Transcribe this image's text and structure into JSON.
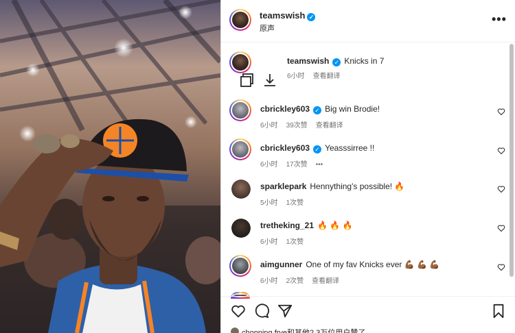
{
  "post": {
    "author": "teamswish",
    "audio": "原声"
  },
  "caption": {
    "author": "teamswish",
    "text": "Knicks in 7",
    "time": "6小时",
    "translate": "查看翻译"
  },
  "comments": [
    {
      "user": "cbrickley603",
      "verified": true,
      "text": "Big win Brodie!",
      "time": "6小时",
      "likes": "39次赞",
      "translate": "查看翻译"
    },
    {
      "user": "cbrickley603",
      "verified": true,
      "text": "Yeasssirree !!",
      "time": "6小时",
      "likes": "17次赞",
      "more": "•••"
    },
    {
      "user": "sparklepark",
      "verified": false,
      "text": "Hennything's possible! 🔥",
      "time": "5小时",
      "likes": "1次赞"
    },
    {
      "user": "tretheking_21",
      "verified": false,
      "text": "🔥 🔥 🔥",
      "time": "6小时",
      "likes": "1次赞"
    },
    {
      "user": "aimgunner",
      "verified": false,
      "text": "One of my fav Knicks ever 💪🏾 💪🏾 💪🏾",
      "time": "6小时",
      "likes": "2次赞",
      "translate": "查看翻译"
    }
  ],
  "footer": {
    "liked_by": "chopping.frye和其他2.3万位用户赞了"
  },
  "icons": {
    "verified": "✓",
    "more": "•••"
  },
  "colors": {
    "accent": "#0095f6",
    "knicks_orange": "#f58426",
    "knicks_blue": "#006bb6"
  }
}
